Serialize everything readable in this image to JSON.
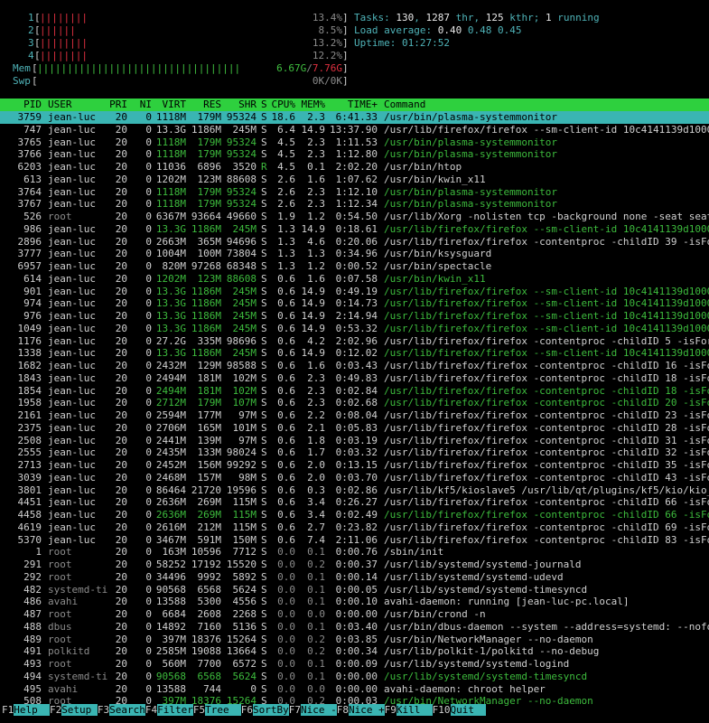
{
  "meters": {
    "cpus": [
      {
        "label": "1",
        "bars": "||||||||",
        "value": "13.4%"
      },
      {
        "label": "2",
        "bars": "||||||",
        "value": "8.5%"
      },
      {
        "label": "3",
        "bars": "||||||||",
        "value": "13.2%"
      },
      {
        "label": "4",
        "bars": "||||||||",
        "value": "12.2%"
      }
    ],
    "mem": {
      "label": "Mem",
      "bars": "||||||||||||||||||||||||||||||||||",
      "used": "6.67G",
      "total": "7.76G"
    },
    "swp": {
      "label": "Swp",
      "bars": "",
      "value": "0K/0K"
    }
  },
  "summary": {
    "tasks_label": "Tasks: ",
    "tasks": "130",
    "thr": "1287",
    "kthr": "125",
    "running": "1",
    "load_label": "Load average: ",
    "load1": "0.40",
    "load5": "0.48",
    "load15": "0.45",
    "uptime_label": "Uptime: ",
    "uptime": "01:27:52"
  },
  "columns": [
    "PID",
    "USER",
    "PRI",
    "NI",
    "VIRT",
    "RES",
    "SHR",
    "S",
    "CPU%",
    "MEM%",
    "TIME+",
    "Command"
  ],
  "processes": [
    [
      "3759",
      "jean-luc",
      "20",
      "0",
      "1118M",
      "179M",
      "95324",
      "S",
      "18.6",
      "2.3",
      "6:41.33",
      "/usr/bin/plasma-systemmonitor",
      "sel"
    ],
    [
      "747",
      "jean-luc",
      "20",
      "0",
      "13.3G",
      "1186M",
      "245M",
      "S",
      "6.4",
      "14.9",
      "13:37.90",
      "/usr/lib/firefox/firefox --sm-client-id 10c4141139d1000",
      ""
    ],
    [
      "3765",
      "jean-luc",
      "20",
      "0",
      "1118M",
      "179M",
      "95324",
      "S",
      "4.5",
      "2.3",
      "1:11.53",
      "/usr/bin/plasma-systemmonitor",
      "green"
    ],
    [
      "3766",
      "jean-luc",
      "20",
      "0",
      "1118M",
      "179M",
      "95324",
      "S",
      "4.5",
      "2.3",
      "1:12.80",
      "/usr/bin/plasma-systemmonitor",
      "green"
    ],
    [
      "6203",
      "jean-luc",
      "20",
      "0",
      "11036",
      "6896",
      "3520",
      "R",
      "4.5",
      "0.1",
      "2:02.20",
      "/usr/bin/htop",
      ""
    ],
    [
      "613",
      "jean-luc",
      "20",
      "0",
      "1202M",
      "123M",
      "88608",
      "S",
      "2.6",
      "1.6",
      "1:07.62",
      "/usr/bin/kwin_x11",
      ""
    ],
    [
      "3764",
      "jean-luc",
      "20",
      "0",
      "1118M",
      "179M",
      "95324",
      "S",
      "2.6",
      "2.3",
      "1:12.10",
      "/usr/bin/plasma-systemmonitor",
      "green"
    ],
    [
      "3767",
      "jean-luc",
      "20",
      "0",
      "1118M",
      "179M",
      "95324",
      "S",
      "2.6",
      "2.3",
      "1:12.34",
      "/usr/bin/plasma-systemmonitor",
      "green"
    ],
    [
      "526",
      "root",
      "20",
      "0",
      "6367M",
      "93664",
      "49660",
      "S",
      "1.9",
      "1.2",
      "0:54.50",
      "/usr/lib/Xorg -nolisten tcp -background none -seat seat",
      ""
    ],
    [
      "986",
      "jean-luc",
      "20",
      "0",
      "13.3G",
      "1186M",
      "245M",
      "S",
      "1.3",
      "14.9",
      "0:18.61",
      "/usr/lib/firefox/firefox --sm-client-id 10c4141139d1000",
      "green"
    ],
    [
      "2896",
      "jean-luc",
      "20",
      "0",
      "2663M",
      "365M",
      "94696",
      "S",
      "1.3",
      "4.6",
      "0:20.06",
      "/usr/lib/firefox/firefox -contentproc -childID 39 -isFo",
      ""
    ],
    [
      "3777",
      "jean-luc",
      "20",
      "0",
      "1004M",
      "100M",
      "73804",
      "S",
      "1.3",
      "1.3",
      "0:34.96",
      "/usr/bin/ksysguard",
      ""
    ],
    [
      "6957",
      "jean-luc",
      "20",
      "0",
      "820M",
      "97268",
      "68348",
      "S",
      "1.3",
      "1.2",
      "0:00.52",
      "/usr/bin/spectacle",
      ""
    ],
    [
      "614",
      "jean-luc",
      "20",
      "0",
      "1202M",
      "123M",
      "88608",
      "S",
      "0.6",
      "1.6",
      "0:07.58",
      "/usr/bin/kwin_x11",
      "green"
    ],
    [
      "901",
      "jean-luc",
      "20",
      "0",
      "13.3G",
      "1186M",
      "245M",
      "S",
      "0.6",
      "14.9",
      "0:49.19",
      "/usr/lib/firefox/firefox --sm-client-id 10c4141139d1000",
      "green"
    ],
    [
      "974",
      "jean-luc",
      "20",
      "0",
      "13.3G",
      "1186M",
      "245M",
      "S",
      "0.6",
      "14.9",
      "0:14.73",
      "/usr/lib/firefox/firefox --sm-client-id 10c4141139d1000",
      "green"
    ],
    [
      "976",
      "jean-luc",
      "20",
      "0",
      "13.3G",
      "1186M",
      "245M",
      "S",
      "0.6",
      "14.9",
      "2:14.94",
      "/usr/lib/firefox/firefox --sm-client-id 10c4141139d1000",
      "green"
    ],
    [
      "1049",
      "jean-luc",
      "20",
      "0",
      "13.3G",
      "1186M",
      "245M",
      "S",
      "0.6",
      "14.9",
      "0:53.32",
      "/usr/lib/firefox/firefox --sm-client-id 10c4141139d1000",
      "green"
    ],
    [
      "1176",
      "jean-luc",
      "20",
      "0",
      "27.2G",
      "335M",
      "98696",
      "S",
      "0.6",
      "4.2",
      "2:02.96",
      "/usr/lib/firefox/firefox -contentproc -childID 5 -isFor",
      ""
    ],
    [
      "1338",
      "jean-luc",
      "20",
      "0",
      "13.3G",
      "1186M",
      "245M",
      "S",
      "0.6",
      "14.9",
      "0:12.02",
      "/usr/lib/firefox/firefox --sm-client-id 10c4141139d1000",
      "green"
    ],
    [
      "1682",
      "jean-luc",
      "20",
      "0",
      "2432M",
      "129M",
      "98588",
      "S",
      "0.6",
      "1.6",
      "0:03.43",
      "/usr/lib/firefox/firefox -contentproc -childID 16 -isFo",
      ""
    ],
    [
      "1843",
      "jean-luc",
      "20",
      "0",
      "2494M",
      "181M",
      "102M",
      "S",
      "0.6",
      "2.3",
      "0:49.83",
      "/usr/lib/firefox/firefox -contentproc -childID 18 -isFo",
      ""
    ],
    [
      "1854",
      "jean-luc",
      "20",
      "0",
      "2494M",
      "181M",
      "102M",
      "S",
      "0.6",
      "2.3",
      "0:02.84",
      "/usr/lib/firefox/firefox -contentproc -childID 18 -isFo",
      "green"
    ],
    [
      "1958",
      "jean-luc",
      "20",
      "0",
      "2712M",
      "179M",
      "107M",
      "S",
      "0.6",
      "2.3",
      "0:02.68",
      "/usr/lib/firefox/firefox -contentproc -childID 20 -isFo",
      "green"
    ],
    [
      "2161",
      "jean-luc",
      "20",
      "0",
      "2594M",
      "177M",
      "97M",
      "S",
      "0.6",
      "2.2",
      "0:08.04",
      "/usr/lib/firefox/firefox -contentproc -childID 23 -isFo",
      ""
    ],
    [
      "2375",
      "jean-luc",
      "20",
      "0",
      "2706M",
      "165M",
      "101M",
      "S",
      "0.6",
      "2.1",
      "0:05.83",
      "/usr/lib/firefox/firefox -contentproc -childID 28 -isFo",
      ""
    ],
    [
      "2508",
      "jean-luc",
      "20",
      "0",
      "2441M",
      "139M",
      "97M",
      "S",
      "0.6",
      "1.8",
      "0:03.19",
      "/usr/lib/firefox/firefox -contentproc -childID 31 -isFo",
      ""
    ],
    [
      "2555",
      "jean-luc",
      "20",
      "0",
      "2435M",
      "133M",
      "98024",
      "S",
      "0.6",
      "1.7",
      "0:03.32",
      "/usr/lib/firefox/firefox -contentproc -childID 32 -isFo",
      ""
    ],
    [
      "2713",
      "jean-luc",
      "20",
      "0",
      "2452M",
      "156M",
      "99292",
      "S",
      "0.6",
      "2.0",
      "0:13.15",
      "/usr/lib/firefox/firefox -contentproc -childID 35 -isFo",
      ""
    ],
    [
      "3039",
      "jean-luc",
      "20",
      "0",
      "2468M",
      "157M",
      "98M",
      "S",
      "0.6",
      "2.0",
      "0:03.70",
      "/usr/lib/firefox/firefox -contentproc -childID 43 -isFo",
      ""
    ],
    [
      "3801",
      "jean-luc",
      "20",
      "0",
      "86464",
      "21720",
      "19596",
      "S",
      "0.6",
      "0.3",
      "0:02.86",
      "/usr/lib/kf5/kioslave5 /usr/lib/qt/plugins/kf5/kio/kio_",
      ""
    ],
    [
      "4451",
      "jean-luc",
      "20",
      "0",
      "2636M",
      "269M",
      "115M",
      "S",
      "0.6",
      "3.4",
      "0:26.27",
      "/usr/lib/firefox/firefox -contentproc -childID 66 -isFo",
      ""
    ],
    [
      "4458",
      "jean-luc",
      "20",
      "0",
      "2636M",
      "269M",
      "115M",
      "S",
      "0.6",
      "3.4",
      "0:02.49",
      "/usr/lib/firefox/firefox -contentproc -childID 66 -isFo",
      "green"
    ],
    [
      "4619",
      "jean-luc",
      "20",
      "0",
      "2616M",
      "212M",
      "115M",
      "S",
      "0.6",
      "2.7",
      "0:23.82",
      "/usr/lib/firefox/firefox -contentproc -childID 69 -isFo",
      ""
    ],
    [
      "5370",
      "jean-luc",
      "20",
      "0",
      "3467M",
      "591M",
      "150M",
      "S",
      "0.6",
      "7.4",
      "2:11.06",
      "/usr/lib/firefox/firefox -contentproc -childID 83 -isFo",
      ""
    ],
    [
      "1",
      "root",
      "20",
      "0",
      "163M",
      "10596",
      "7712",
      "S",
      "0.0",
      "0.1",
      "0:00.76",
      "/sbin/init",
      ""
    ],
    [
      "291",
      "root",
      "20",
      "0",
      "58252",
      "17192",
      "15520",
      "S",
      "0.0",
      "0.2",
      "0:00.37",
      "/usr/lib/systemd/systemd-journald",
      ""
    ],
    [
      "292",
      "root",
      "20",
      "0",
      "34496",
      "9992",
      "5892",
      "S",
      "0.0",
      "0.1",
      "0:00.14",
      "/usr/lib/systemd/systemd-udevd",
      ""
    ],
    [
      "482",
      "systemd-ti",
      "20",
      "0",
      "90568",
      "6568",
      "5624",
      "S",
      "0.0",
      "0.1",
      "0:00.05",
      "/usr/lib/systemd/systemd-timesyncd",
      ""
    ],
    [
      "486",
      "avahi",
      "20",
      "0",
      "13588",
      "5300",
      "4556",
      "S",
      "0.0",
      "0.1",
      "0:00.10",
      "avahi-daemon: running [jean-luc-pc.local]",
      ""
    ],
    [
      "487",
      "root",
      "20",
      "0",
      "6684",
      "2608",
      "2268",
      "S",
      "0.0",
      "0.0",
      "0:00.00",
      "/usr/bin/crond -n",
      ""
    ],
    [
      "488",
      "dbus",
      "20",
      "0",
      "14892",
      "7160",
      "5136",
      "S",
      "0.0",
      "0.1",
      "0:03.40",
      "/usr/bin/dbus-daemon --system --address=systemd: --nofo",
      ""
    ],
    [
      "489",
      "root",
      "20",
      "0",
      "397M",
      "18376",
      "15264",
      "S",
      "0.0",
      "0.2",
      "0:03.85",
      "/usr/bin/NetworkManager --no-daemon",
      ""
    ],
    [
      "491",
      "polkitd",
      "20",
      "0",
      "2585M",
      "19088",
      "13664",
      "S",
      "0.0",
      "0.2",
      "0:00.34",
      "/usr/lib/polkit-1/polkitd --no-debug",
      ""
    ],
    [
      "493",
      "root",
      "20",
      "0",
      "560M",
      "7700",
      "6572",
      "S",
      "0.0",
      "0.1",
      "0:00.09",
      "/usr/lib/systemd/systemd-logind",
      ""
    ],
    [
      "494",
      "systemd-ti",
      "20",
      "0",
      "90568",
      "6568",
      "5624",
      "S",
      "0.0",
      "0.1",
      "0:00.00",
      "/usr/lib/systemd/systemd-timesyncd",
      "green"
    ],
    [
      "495",
      "avahi",
      "20",
      "0",
      "13588",
      "744",
      "0",
      "S",
      "0.0",
      "0.0",
      "0:00.00",
      "avahi-daemon: chroot helper",
      ""
    ],
    [
      "508",
      "root",
      "20",
      "0",
      "397M",
      "18376",
      "15264",
      "S",
      "0.0",
      "0.2",
      "0:00.03",
      "/usr/bin/NetworkManager --no-daemon",
      "green"
    ]
  ],
  "footer": [
    {
      "key": "F1",
      "label": "Help  "
    },
    {
      "key": "F2",
      "label": "Setup "
    },
    {
      "key": "F3",
      "label": "Search"
    },
    {
      "key": "F4",
      "label": "Filter"
    },
    {
      "key": "F5",
      "label": "Tree  "
    },
    {
      "key": "F6",
      "label": "SortBy"
    },
    {
      "key": "F7",
      "label": "Nice -"
    },
    {
      "key": "F8",
      "label": "Nice +"
    },
    {
      "key": "F9",
      "label": "Kill  "
    },
    {
      "key": "F10",
      "label": "Quit  "
    }
  ],
  "colors": {
    "header_bg": "#2ed03e",
    "selected_bg": "#3ab5b3",
    "cyan": "#4fb3b8",
    "green": "#3dbb3d",
    "red": "#e03040"
  }
}
